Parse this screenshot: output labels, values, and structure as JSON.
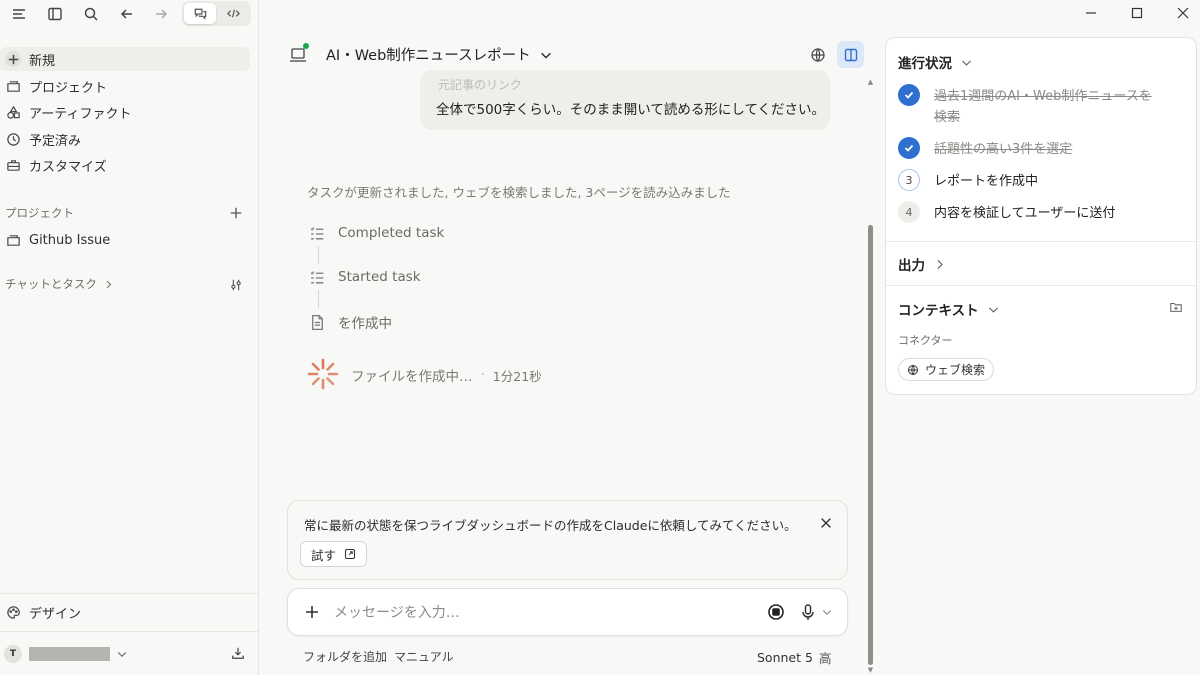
{
  "sidebar": {
    "nav": [
      {
        "label": "新規",
        "icon": "plus-icon"
      },
      {
        "label": "プロジェクト",
        "icon": "folder-icon"
      },
      {
        "label": "アーティファクト",
        "icon": "shapes-icon"
      },
      {
        "label": "予定済み",
        "icon": "clock-icon"
      },
      {
        "label": "カスタマイズ",
        "icon": "briefcase-icon"
      }
    ],
    "projects_label": "プロジェクト",
    "project_items": [
      {
        "label": "Github Issue"
      }
    ],
    "chats_label": "チャットとタスク",
    "design_label": "デザイン",
    "user_initial": "T"
  },
  "main": {
    "chat_title": "AI・Web制作ニュースレポート",
    "user_message_faded": "元記事のリンク",
    "user_message": "全体で500字くらい。そのまま開いて読める形にしてください。",
    "status_line": "タスクが更新されました, ウェブを検索しました, 3ページを読み込みました",
    "steps": [
      {
        "label": "Completed task",
        "icon": "task-list-icon"
      },
      {
        "label": "Started task",
        "icon": "task-list-icon"
      },
      {
        "label": "を作成中",
        "icon": "document-icon"
      }
    ],
    "working_label": "ファイルを作成中…",
    "elapsed": "1分21秒",
    "tip": {
      "text": "常に最新の状態を保つライブダッシュボードの作成をClaudeに依頼してみてください。",
      "try_label": "試す"
    },
    "composer": {
      "placeholder": "メッセージを入力…"
    },
    "footer": {
      "add_folder": "フォルダを追加",
      "manual": "マニュアル",
      "model": "Sonnet 5",
      "effort": "高"
    },
    "accent": "#2f6fd0",
    "spinner_color": "#d97757"
  },
  "panel": {
    "progress_title": "進行状況",
    "progress": [
      {
        "num": "1",
        "label": "過去1週間のAI・Web制作ニュースを検索",
        "status": "done"
      },
      {
        "num": "2",
        "label": "話題性の高い3件を選定",
        "status": "done"
      },
      {
        "num": "3",
        "label": "レポートを作成中",
        "status": "current"
      },
      {
        "num": "4",
        "label": "内容を検証してユーザーに送付",
        "status": "pending"
      }
    ],
    "output_title": "出力",
    "context_title": "コンテキスト",
    "connectors_label": "コネクター",
    "connector_chip": "ウェブ検索"
  }
}
